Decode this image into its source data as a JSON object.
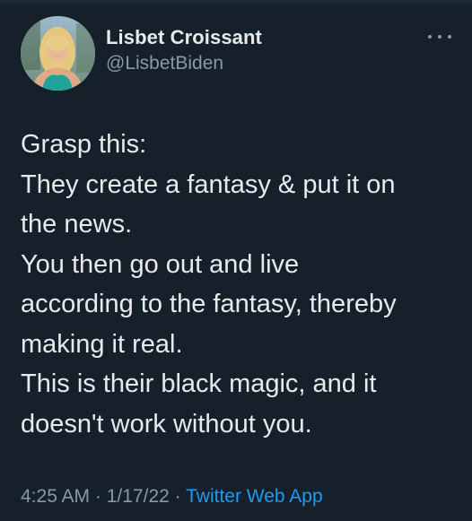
{
  "author": {
    "display_name": "Lisbet Croissant",
    "handle": "@LisbetBiden",
    "avatar_icon": "profile-photo"
  },
  "more_icon": "more-options-icon",
  "tweet": {
    "lines": [
      "Grasp this:",
      "They create a fantasy & put it on",
      "the news.",
      "You then go out and live",
      "according to the fantasy, thereby",
      "making it real.",
      "This is their black magic, and it",
      "doesn't work without you."
    ]
  },
  "meta": {
    "time": "4:25 AM",
    "date": "1/17/22",
    "separator": "·",
    "source": "Twitter Web App"
  },
  "colors": {
    "background": "#15202b",
    "text": "#e7e9ea",
    "secondary": "#8b98a5",
    "link": "#1d9bf0"
  }
}
